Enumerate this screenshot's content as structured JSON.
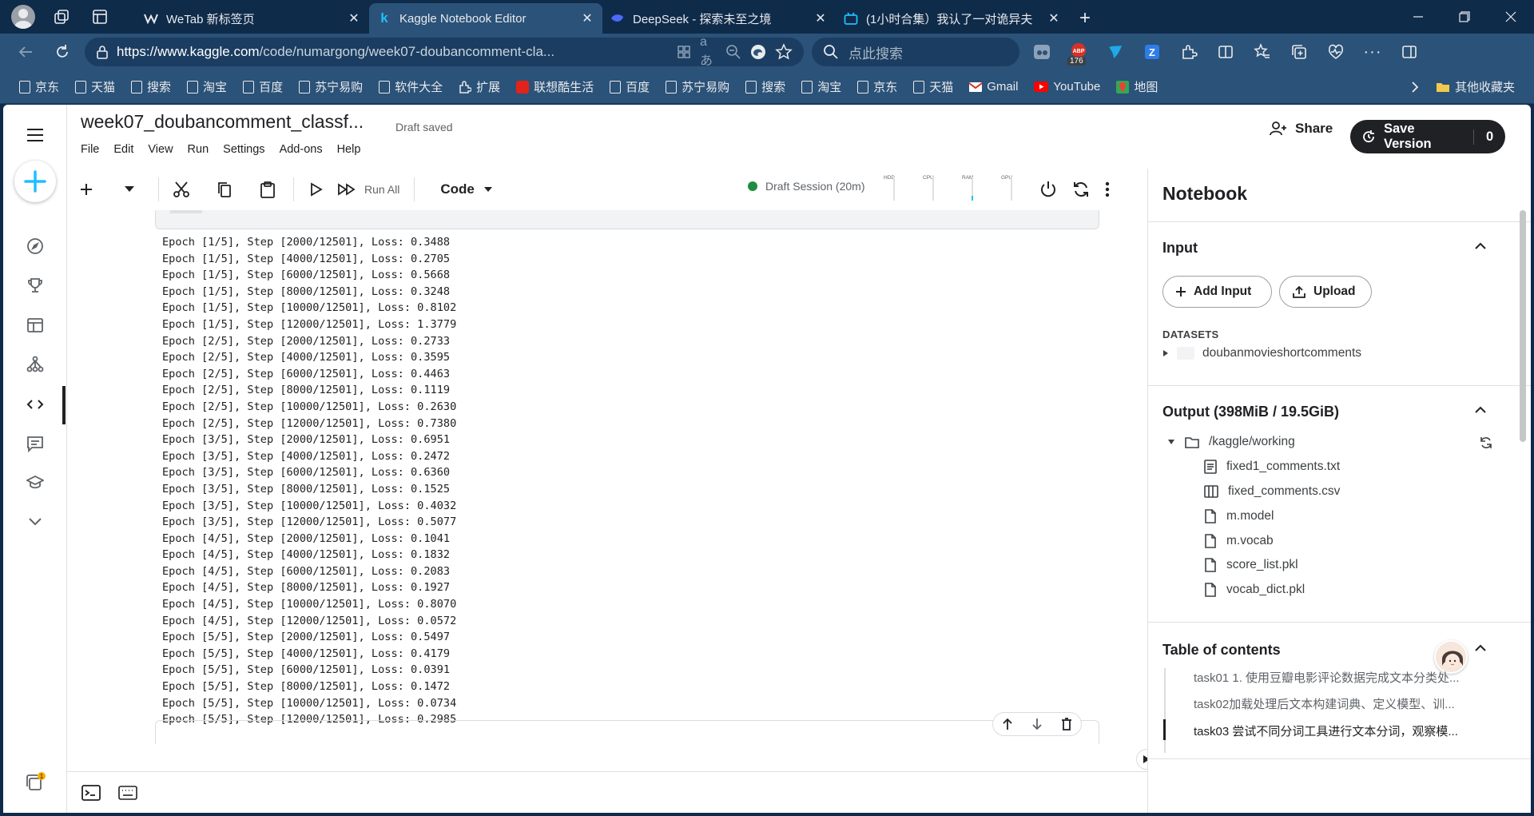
{
  "browser": {
    "tabs": [
      {
        "title": "WeTab 新标签页",
        "icon": "wetab-icon",
        "active": false
      },
      {
        "title": "Kaggle Notebook Editor",
        "icon": "kaggle-icon",
        "active": true
      },
      {
        "title": "DeepSeek - 探索未至之境",
        "icon": "deepseek-icon",
        "active": false
      },
      {
        "title": "(1小时合集）我认了一对诡异夫",
        "icon": "bilibili-icon",
        "active": false
      }
    ],
    "url_host": "https://www.kaggle.com",
    "url_path": "/code/numargong/week07-doubancomment-cla...",
    "search_placeholder": "点此搜索",
    "ext_badge": "176",
    "bookmarks": [
      "京东",
      "天猫",
      "搜索",
      "淘宝",
      "百度",
      "苏宁易购",
      "软件大全",
      "扩展",
      "联想酷生活",
      "百度",
      "苏宁易购",
      "搜索",
      "淘宝",
      "京东",
      "天猫",
      "Gmail",
      "YouTube",
      "地图"
    ],
    "other_bookmarks": "其他收藏夹"
  },
  "notebook": {
    "title": "week07_doubancomment_classf...",
    "status": "Draft saved",
    "menus": [
      "File",
      "Edit",
      "View",
      "Run",
      "Settings",
      "Add-ons",
      "Help"
    ],
    "share_label": "Share",
    "save_label": "Save Version",
    "save_count": "0",
    "run_all_label": "Run All",
    "cell_type": "Code",
    "session_label": "Draft Session (20m)",
    "meters": [
      "HDD",
      "CPU",
      "RAM",
      "GPU"
    ]
  },
  "output_lines": [
    "Epoch [1/5], Step [2000/12501], Loss: 0.3488",
    "Epoch [1/5], Step [4000/12501], Loss: 0.2705",
    "Epoch [1/5], Step [6000/12501], Loss: 0.5668",
    "Epoch [1/5], Step [8000/12501], Loss: 0.3248",
    "Epoch [1/5], Step [10000/12501], Loss: 0.8102",
    "Epoch [1/5], Step [12000/12501], Loss: 1.3779",
    "Epoch [2/5], Step [2000/12501], Loss: 0.2733",
    "Epoch [2/5], Step [4000/12501], Loss: 0.3595",
    "Epoch [2/5], Step [6000/12501], Loss: 0.4463",
    "Epoch [2/5], Step [8000/12501], Loss: 0.1119",
    "Epoch [2/5], Step [10000/12501], Loss: 0.2630",
    "Epoch [2/5], Step [12000/12501], Loss: 0.7380",
    "Epoch [3/5], Step [2000/12501], Loss: 0.6951",
    "Epoch [3/5], Step [4000/12501], Loss: 0.2472",
    "Epoch [3/5], Step [6000/12501], Loss: 0.6360",
    "Epoch [3/5], Step [8000/12501], Loss: 0.1525",
    "Epoch [3/5], Step [10000/12501], Loss: 0.4032",
    "Epoch [3/5], Step [12000/12501], Loss: 0.5077",
    "Epoch [4/5], Step [2000/12501], Loss: 0.1041",
    "Epoch [4/5], Step [4000/12501], Loss: 0.1832",
    "Epoch [4/5], Step [6000/12501], Loss: 0.2083",
    "Epoch [4/5], Step [8000/12501], Loss: 0.1927",
    "Epoch [4/5], Step [10000/12501], Loss: 0.8070",
    "Epoch [4/5], Step [12000/12501], Loss: 0.0572",
    "Epoch [5/5], Step [2000/12501], Loss: 0.5497",
    "Epoch [5/5], Step [4000/12501], Loss: 0.4179",
    "Epoch [5/5], Step [6000/12501], Loss: 0.0391",
    "Epoch [5/5], Step [8000/12501], Loss: 0.1472",
    "Epoch [5/5], Step [10000/12501], Loss: 0.0734",
    "Epoch [5/5], Step [12000/12501], Loss: 0.2985"
  ],
  "sidebar": {
    "title": "Notebook",
    "input_heading": "Input",
    "add_input_label": "Add Input",
    "upload_label": "Upload",
    "datasets_label": "DATASETS",
    "dataset_name": "doubanmovieshortcomments",
    "output_heading": "Output (398MiB / 19.5GiB)",
    "working_dir": "/kaggle/working",
    "files": [
      {
        "name": "fixed1_comments.txt",
        "icon": "text-file-icon"
      },
      {
        "name": "fixed_comments.csv",
        "icon": "table-file-icon"
      },
      {
        "name": "m.model",
        "icon": "file-icon"
      },
      {
        "name": "m.vocab",
        "icon": "file-icon"
      },
      {
        "name": "score_list.pkl",
        "icon": "file-icon"
      },
      {
        "name": "vocab_dict.pkl",
        "icon": "file-icon"
      }
    ],
    "toc_heading": "Table of contents",
    "toc": [
      "task01 1. 使用豆瓣电影评论数据完成文本分类处...",
      "task02加载处理后文本构建词典、定义模型、训...",
      "task03 尝试不同分词工具进行文本分词，观察模..."
    ]
  },
  "colors": {
    "browser_frame": "#0f2b4a",
    "browser_toolbar": "#2b5278",
    "kaggle_blue": "#20beff",
    "session_green": "#1e8e3e"
  }
}
